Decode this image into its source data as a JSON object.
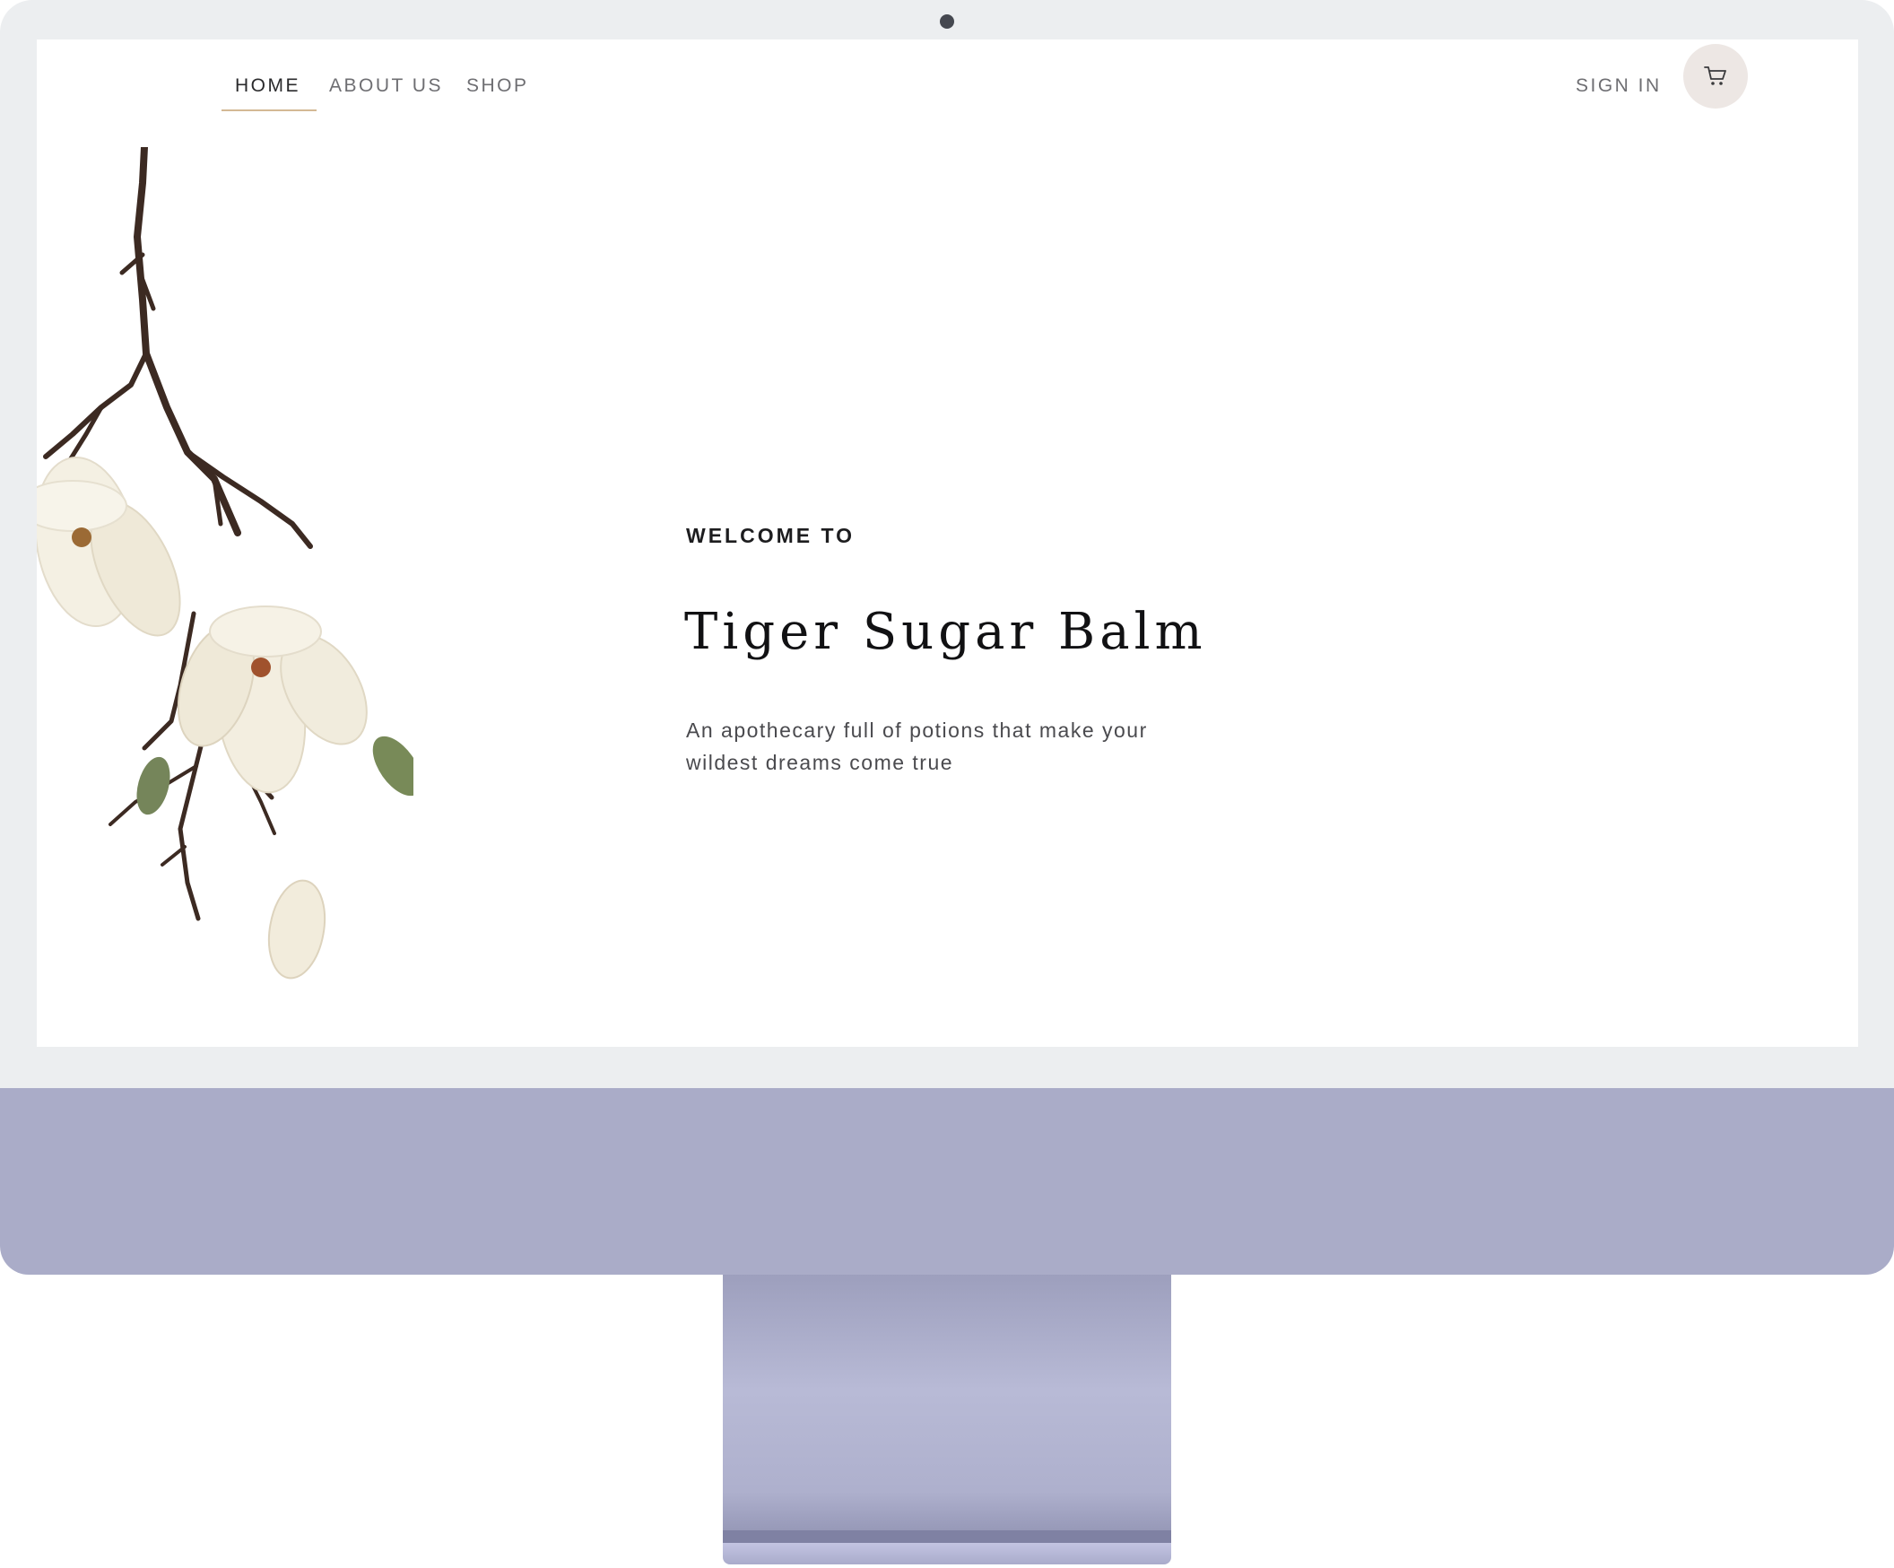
{
  "nav": {
    "items": [
      {
        "label": "HOME",
        "active": true
      },
      {
        "label": "ABOUT US",
        "active": false
      },
      {
        "label": "SHOP",
        "active": false
      }
    ],
    "sign_in_label": "SIGN IN",
    "cart_icon": "shopping-cart-icon",
    "active_underline_color": "#d4b995"
  },
  "hero": {
    "eyebrow": "WELCOME TO",
    "title": "Tiger Sugar Balm",
    "tagline_line1": "An apothecary full of potions that make your",
    "tagline_line2": "wildest dreams come true",
    "image_subject": "magnolia-branch"
  },
  "device": {
    "frame_color": "#eceef0",
    "chin_color": "#aaacc8"
  }
}
